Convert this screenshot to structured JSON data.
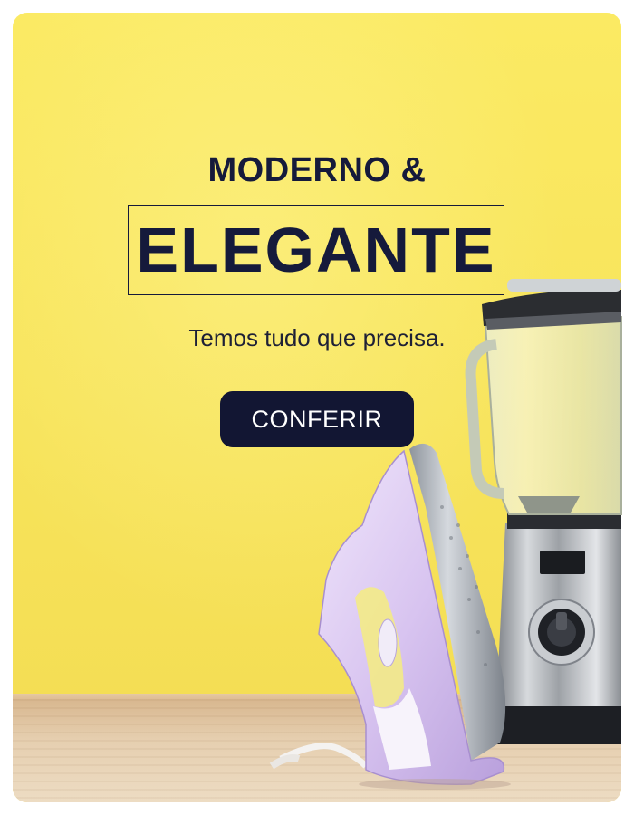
{
  "banner": {
    "heading_small": "MODERNO &",
    "heading_large": "ELEGANTE",
    "subtitle": "Temos tudo que precisa.",
    "cta_label": "CONFERIR"
  },
  "colors": {
    "background_yellow": "#f7e35a",
    "text_navy": "#151a3b",
    "button_navy": "#121633",
    "button_text": "#ffffff",
    "iron_purple": "#d9c6ef",
    "blender_steel": "#b8bcc2"
  },
  "images": {
    "blender": "blender-illustration",
    "iron": "clothes-iron-illustration",
    "table": "wooden-table-surface"
  }
}
